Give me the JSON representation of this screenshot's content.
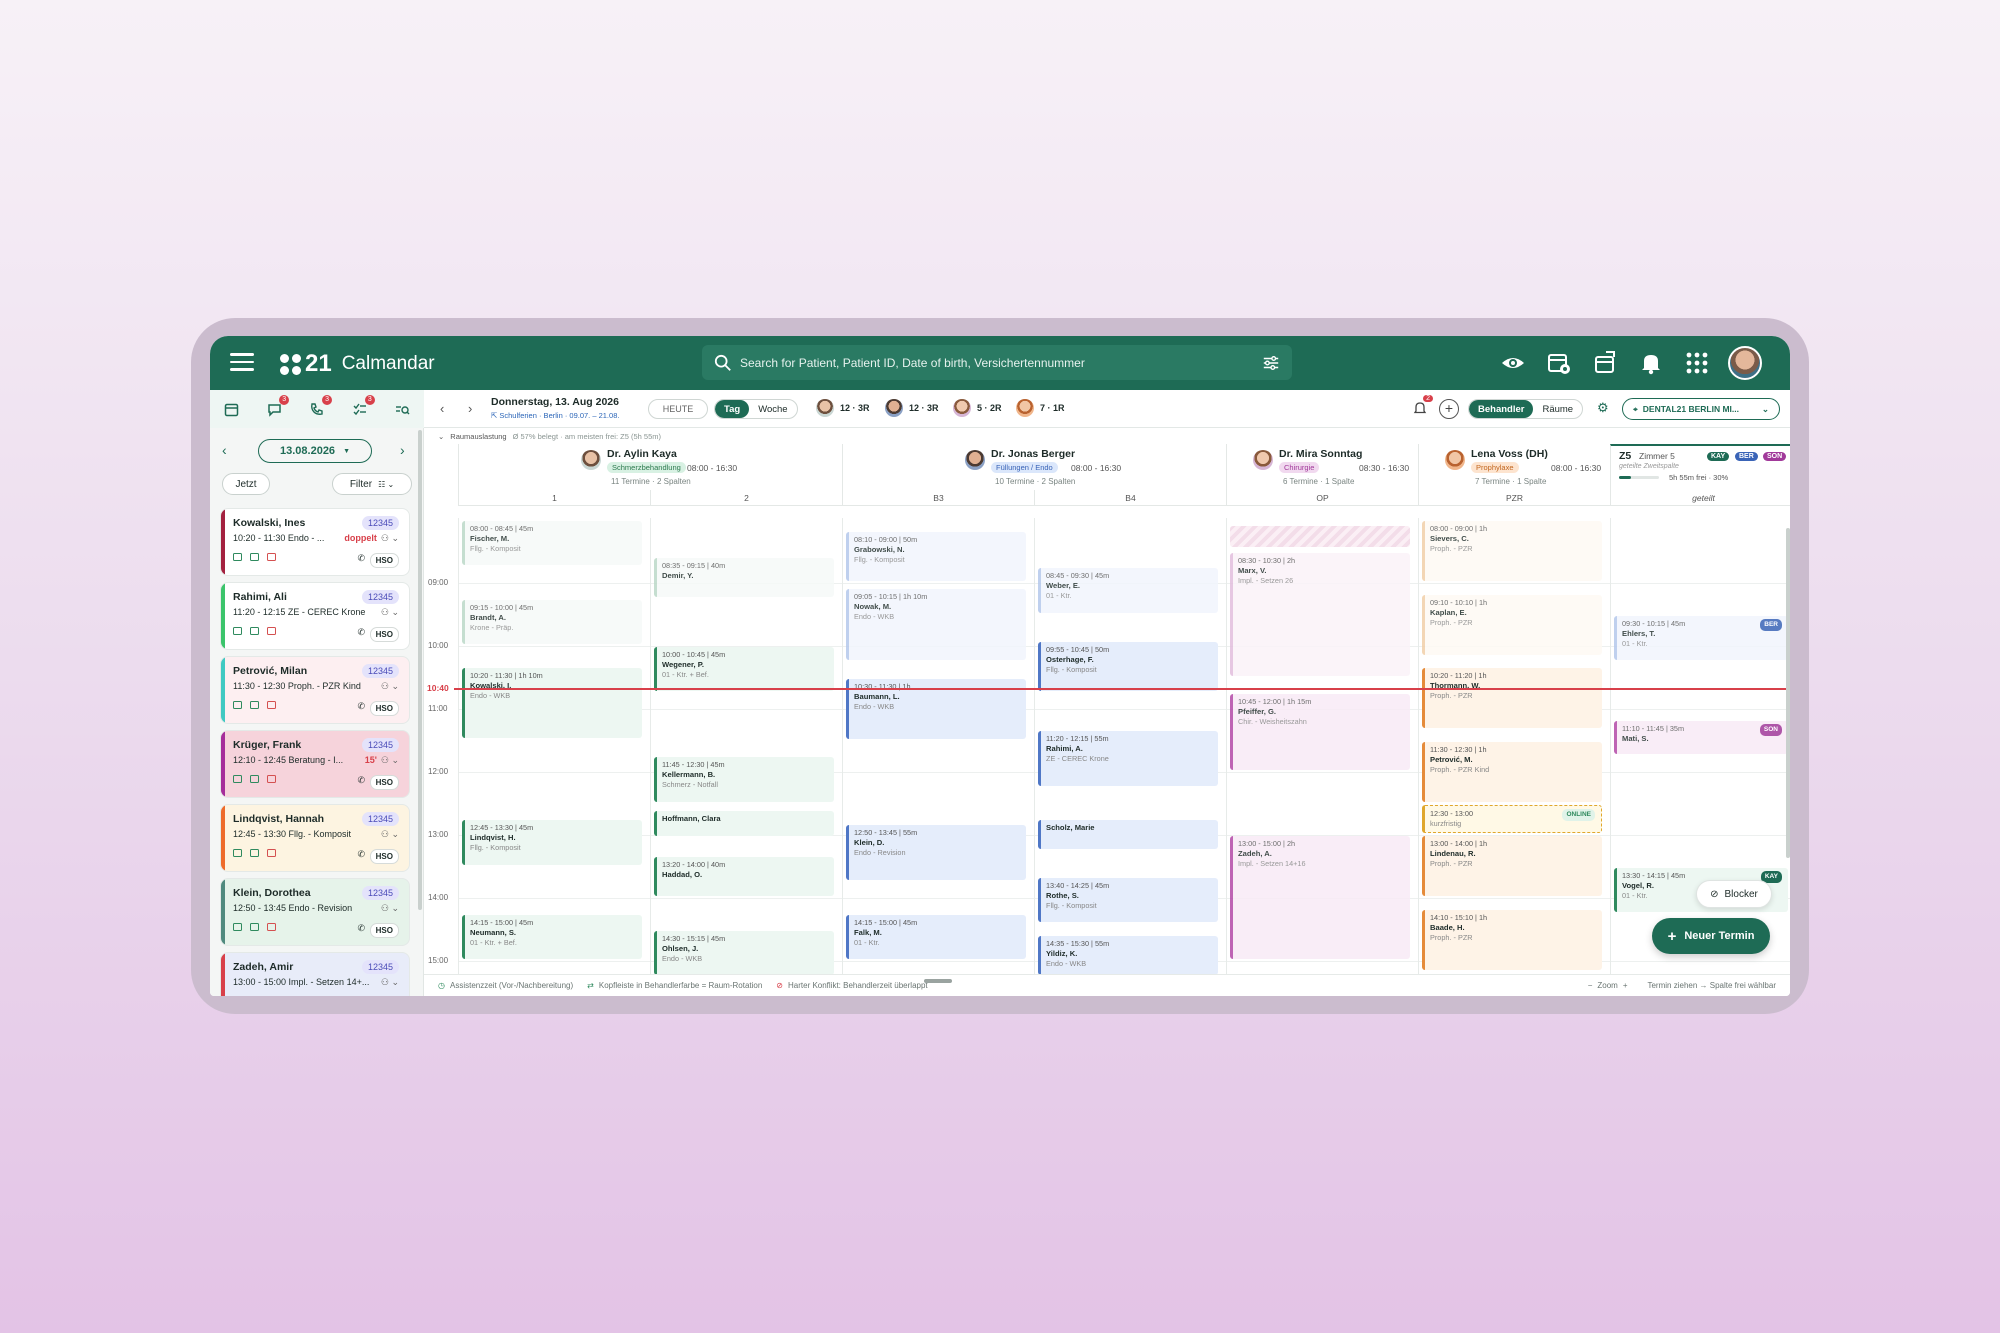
{
  "app": {
    "logo_num": "21",
    "title": "Calmandar"
  },
  "search": {
    "placeholder": "Search for Patient, Patient ID, Date of birth, Versichertennummer"
  },
  "left_tabs": {
    "badges": [
      "3",
      "3",
      "3"
    ]
  },
  "sidebar": {
    "date": "13.08.2026",
    "now_button": "Jetzt",
    "filter_button": "Filter",
    "cards": [
      {
        "name": "Kowalski, Ines",
        "id": "12345",
        "time": "10:20 - 11:30 Endo - ...",
        "status": "doppelt",
        "hs": "HSO",
        "color": "#a3213f",
        "bg": "#ffffff"
      },
      {
        "name": "Rahimi, Ali",
        "id": "12345",
        "time": "11:20 - 12:15 ZE - CEREC Krone",
        "status": "",
        "hs": "HSO",
        "color": "#3bc46b",
        "bg": "#ffffff"
      },
      {
        "name": "Petrović, Milan",
        "id": "12345",
        "time": "11:30 - 12:30 Proph. - PZR Kind",
        "status": "",
        "hs": "HSO",
        "color": "#40c9c2",
        "bg": "#fdeff1"
      },
      {
        "name": "Krüger, Frank",
        "id": "12345",
        "time": "12:10 - 12:45 Beratung - I...",
        "status": "15'",
        "hs": "HSO",
        "color": "#a52d9a",
        "bg": "#f6d3db"
      },
      {
        "name": "Lindqvist, Hannah",
        "id": "12345",
        "time": "12:45 - 13:30 Fllg. - Komposit",
        "status": "",
        "hs": "HSO",
        "color": "#ee6b2a",
        "bg": "#fdf4e1"
      },
      {
        "name": "Klein, Dorothea",
        "id": "12345",
        "time": "12:50 - 13:45 Endo - Revision",
        "status": "",
        "hs": "HSO",
        "color": "#4f8a7e",
        "bg": "#e6f3ea"
      },
      {
        "name": "Zadeh, Amir",
        "id": "12345",
        "time": "13:00 - 15:00 Impl. - Setzen 14+...",
        "status": "",
        "hs": "",
        "color": "#d8404a",
        "bg": "#e8ecf9"
      }
    ]
  },
  "toolbar": {
    "date_title": "Donnerstag, 13. Aug 2026",
    "holiday": "Schulferien · Berlin · 09.07. – 21.08.",
    "today": "HEUTE",
    "view_day": "Tag",
    "view_week": "Woche",
    "practitioners": [
      "12 · 3R",
      "12 · 3R",
      "5 · 2R",
      "7 · 1R"
    ],
    "notif_count": "2",
    "mode_practitioner": "Behandler",
    "mode_rooms": "Räume",
    "location": "DENTAL21 BERLIN MI...",
    "room_usage": "Raumauslastung",
    "room_usage_detail": "Ø 57% belegt · am meisten frei: Z5 (5h 55m)"
  },
  "columns": [
    {
      "name": "Dr. Aylin Kaya",
      "spec": "Schmerzbehandlung",
      "hours": "08:00 - 16:30",
      "meta": "11 Termine · 2 Spalten",
      "subs": [
        "1",
        "2"
      ]
    },
    {
      "name": "Dr. Jonas Berger",
      "spec": "Füllungen / Endo",
      "hours": "08:00 - 16:30",
      "meta": "10 Termine · 2 Spalten",
      "subs": [
        "B3",
        "B4"
      ]
    },
    {
      "name": "Dr. Mira Sonntag",
      "spec": "Chirurgie",
      "hours": "08:30 - 16:30",
      "meta": "6 Termine · 1 Spalte",
      "subs": [
        "OP"
      ]
    },
    {
      "name": "Lena Voss (DH)",
      "spec": "Prophylaxe",
      "hours": "08:00 - 16:30",
      "meta": "7 Termine · 1 Spalte",
      "subs": [
        "PZR"
      ]
    }
  ],
  "room": {
    "code": "Z5",
    "name": "Zimmer 5",
    "sub": "geteilte Zweitspalte",
    "free": "5h 55m frei · 30%",
    "chips": [
      "KAY",
      "BER",
      "SON"
    ],
    "col": "geteilt"
  },
  "times": [
    "09:00",
    "10:00",
    "11:00",
    "12:00",
    "13:00",
    "14:00",
    "15:00"
  ],
  "now_label": "10:40",
  "events": [
    {
      "c": 0,
      "s": 8.0,
      "e": 8.75,
      "time": "08:00 - 08:45 | 45m",
      "name": "Fischer, M.",
      "desc": "Fllg. - Komposit",
      "type": "gp"
    },
    {
      "c": 0,
      "s": 9.25,
      "e": 10.0,
      "time": "09:15 - 10:00 | 45m",
      "name": "Brandt, A.",
      "desc": "Krone - Präp.",
      "type": "gp"
    },
    {
      "c": 0,
      "s": 10.33,
      "e": 11.5,
      "time": "10:20 - 11:30 | 1h 10m",
      "name": "Kowalski, I.",
      "desc": "Endo - WKB",
      "type": "g"
    },
    {
      "c": 0,
      "s": 12.75,
      "e": 13.5,
      "time": "12:45 - 13:30 | 45m",
      "name": "Lindqvist, H.",
      "desc": "Fllg. - Komposit",
      "type": "g"
    },
    {
      "c": 0,
      "s": 14.25,
      "e": 15.0,
      "time": "14:15 - 15:00 | 45m",
      "name": "Neumann, S.",
      "desc": "01 - Ktr. + Bef.",
      "type": "g"
    },
    {
      "c": 1,
      "s": 8.58,
      "e": 9.25,
      "time": "08:35 - 09:15 | 40m",
      "name": "Demir, Y.",
      "desc": "",
      "type": "gp"
    },
    {
      "c": 1,
      "s": 10.0,
      "e": 10.75,
      "time": "10:00 - 10:45 | 45m",
      "name": "Wegener, P.",
      "desc": "01 - Ktr. + Bef.",
      "type": "g"
    },
    {
      "c": 1,
      "s": 11.75,
      "e": 12.5,
      "time": "11:45 - 12:30 | 45m",
      "name": "Kellermann, B.",
      "desc": "Schmerz - Notfall",
      "type": "g"
    },
    {
      "c": 1,
      "s": 12.6,
      "e": 13.05,
      "time": "",
      "name": "Hoffmann, Clara",
      "desc": "",
      "type": "g"
    },
    {
      "c": 1,
      "s": 13.33,
      "e": 14.0,
      "time": "13:20 - 14:00 | 40m",
      "name": "Haddad, O.",
      "desc": "",
      "type": "g"
    },
    {
      "c": 1,
      "s": 14.5,
      "e": 15.25,
      "time": "14:30 - 15:15 | 45m",
      "name": "Ohlsen, J.",
      "desc": "Endo - WKB",
      "type": "g"
    },
    {
      "c": 2,
      "s": 8.17,
      "e": 9.0,
      "time": "08:10 - 09:00 | 50m",
      "name": "Grabowski, N.",
      "desc": "Fllg. - Komposit",
      "type": "bp"
    },
    {
      "c": 2,
      "s": 9.08,
      "e": 10.25,
      "time": "09:05 - 10:15 | 1h 10m",
      "name": "Nowak, M.",
      "desc": "Endo - WKB",
      "type": "bp"
    },
    {
      "c": 2,
      "s": 10.5,
      "e": 11.5,
      "time": "10:30 - 11:30 | 1h",
      "name": "Baumann, L.",
      "desc": "Endo - WKB",
      "type": "b"
    },
    {
      "c": 2,
      "s": 12.83,
      "e": 13.75,
      "time": "12:50 - 13:45 | 55m",
      "name": "Klein, D.",
      "desc": "Endo - Revision",
      "type": "b"
    },
    {
      "c": 2,
      "s": 14.25,
      "e": 15.0,
      "time": "14:15 - 15:00 | 45m",
      "name": "Falk, M.",
      "desc": "01 - Ktr.",
      "type": "b"
    },
    {
      "c": 3,
      "s": 8.75,
      "e": 9.5,
      "time": "08:45 - 09:30 | 45m",
      "name": "Weber, E.",
      "desc": "01 - Ktr.",
      "type": "bp"
    },
    {
      "c": 3,
      "s": 9.92,
      "e": 10.75,
      "time": "09:55 - 10:45 | 50m",
      "name": "Osterhage, F.",
      "desc": "Fllg. - Komposit",
      "type": "b"
    },
    {
      "c": 3,
      "s": 11.33,
      "e": 12.25,
      "time": "11:20 - 12:15 | 55m",
      "name": "Rahimi, A.",
      "desc": "ZE - CEREC Krone",
      "type": "b"
    },
    {
      "c": 3,
      "s": 12.75,
      "e": 13.25,
      "time": "",
      "name": "Scholz, Marie",
      "desc": "",
      "type": "b"
    },
    {
      "c": 3,
      "s": 13.67,
      "e": 14.42,
      "time": "13:40 - 14:25 | 45m",
      "name": "Rothe, S.",
      "desc": "Fllg. - Komposit",
      "type": "b"
    },
    {
      "c": 3,
      "s": 14.58,
      "e": 15.25,
      "time": "14:35 - 15:30 | 55m",
      "name": "Yildiz, K.",
      "desc": "Endo - WKB",
      "type": "b"
    },
    {
      "c": 4,
      "s": 8.5,
      "e": 10.5,
      "time": "08:30 - 10:30 | 2h",
      "name": "Marx, V.",
      "desc": "Impl. - Setzen 26",
      "type": "pp"
    },
    {
      "c": 4,
      "s": 10.75,
      "e": 12.0,
      "time": "10:45 - 12:00 | 1h 15m",
      "name": "Pfeiffer, G.",
      "desc": "Chir. - Weisheitszahn",
      "type": "p"
    },
    {
      "c": 4,
      "s": 13.0,
      "e": 15.0,
      "time": "13:00 - 15:00 | 2h",
      "name": "Zadeh, A.",
      "desc": "Impl. - Setzen 14+16",
      "type": "p"
    },
    {
      "c": 5,
      "s": 8.0,
      "e": 9.0,
      "time": "08:00 - 09:00 | 1h",
      "name": "Sievers, C.",
      "desc": "Proph. - PZR",
      "type": "op"
    },
    {
      "c": 5,
      "s": 9.17,
      "e": 10.17,
      "time": "09:10 - 10:10 | 1h",
      "name": "Kaplan, E.",
      "desc": "Proph. - PZR",
      "type": "op"
    },
    {
      "c": 5,
      "s": 10.33,
      "e": 11.33,
      "time": "10:20 - 11:20 | 1h",
      "name": "Thormann, W.",
      "desc": "Proph. - PZR",
      "type": "o"
    },
    {
      "c": 5,
      "s": 11.5,
      "e": 12.5,
      "time": "11:30 - 12:30 | 1h",
      "name": "Petrović, M.",
      "desc": "Proph. - PZR Kind",
      "type": "o"
    },
    {
      "c": 5,
      "s": 12.5,
      "e": 13.0,
      "time": "12:30 - 13:00",
      "name": "",
      "desc": "kurzfristig",
      "type": "y",
      "tag": "ONLINE"
    },
    {
      "c": 5,
      "s": 13.0,
      "e": 14.0,
      "time": "13:00 - 14:00 | 1h",
      "name": "Lindenau, R.",
      "desc": "Proph. - PZR",
      "type": "o"
    },
    {
      "c": 5,
      "s": 14.17,
      "e": 15.17,
      "time": "14:10 - 15:10 | 1h",
      "name": "Baade, H.",
      "desc": "Proph. - PZR",
      "type": "o"
    },
    {
      "c": 6,
      "s": 9.5,
      "e": 10.25,
      "time": "09:30 - 10:15 | 45m",
      "name": "Ehlers, T.",
      "desc": "01 - Ktr.",
      "type": "bp",
      "tag": "BER"
    },
    {
      "c": 6,
      "s": 11.17,
      "e": 11.75,
      "time": "11:10 - 11:45 | 35m",
      "name": "Mati, S.",
      "desc": "",
      "type": "p",
      "tag": "SON"
    },
    {
      "c": 6,
      "s": 13.5,
      "e": 14.25,
      "time": "13:30 - 14:15 | 45m",
      "name": "Vogel, R.",
      "desc": "01 - Ktr.",
      "type": "g",
      "tag": "KAY"
    }
  ],
  "footer": {
    "legend1": "Assistenzzeit (Vor-/Nachbereitung)",
    "legend2": "Kopfleiste in Behandlerfarbe = Raum-Rotation",
    "legend3": "Harter Konflikt: Behandlerzeit überlappt",
    "zoom": "Zoom",
    "hint": "Termin ziehen → Spalte frei wählbar"
  },
  "blocker_label": "Blocker",
  "new_appt_label": "Neuer Termin"
}
